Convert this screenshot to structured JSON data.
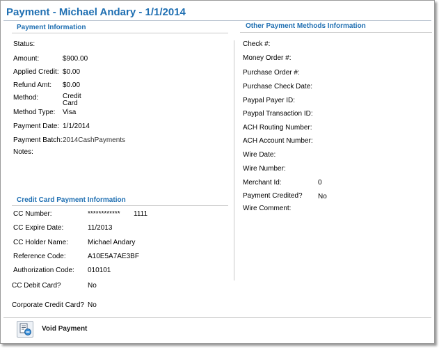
{
  "title": "Payment - Michael Andary - 1/1/2014",
  "payment_info": {
    "heading": "Payment Information",
    "fields": [
      {
        "label": "Status:",
        "value": ""
      },
      {
        "label": "Amount:",
        "value": "$900.00"
      },
      {
        "label": "Applied Credit:",
        "value": "$0.00"
      },
      {
        "label": "Refund Amt:",
        "value": "$0.00"
      },
      {
        "label": "Method:",
        "value": "Credit Card"
      },
      {
        "label": "Method Type:",
        "value": "Visa"
      },
      {
        "label": "Payment Date:",
        "value": "1/1/2014"
      },
      {
        "label": "Payment Batch:",
        "value": "2014CashPayments"
      },
      {
        "label": "Notes:",
        "value": ""
      }
    ]
  },
  "cc_info": {
    "heading": "Credit Card Payment Information",
    "fields": [
      {
        "label": "CC Number:",
        "value": "************",
        "value2": "1111"
      },
      {
        "label": "CC Expire Date:",
        "value": "11/2013"
      },
      {
        "label": "CC Holder Name:",
        "value": "Michael Andary"
      },
      {
        "label": "Reference Code:",
        "value": "A10E5A7AE3BF"
      },
      {
        "label": "Authorization Code:",
        "value": "010101"
      },
      {
        "label": "CC Debit Card?",
        "value": "No"
      },
      {
        "label": "Corporate Credit Card?",
        "value": "No"
      }
    ]
  },
  "other_info": {
    "heading": "Other Payment Methods Information",
    "fields": [
      {
        "label": "Check #:",
        "value": ""
      },
      {
        "label": "Money Order #:",
        "value": ""
      },
      {
        "label": "Purchase Order #:",
        "value": ""
      },
      {
        "label": "Purchase Check Date:",
        "value": ""
      },
      {
        "label": "Paypal Payer ID:",
        "value": ""
      },
      {
        "label": "Paypal Transaction ID:",
        "value": ""
      },
      {
        "label": "ACH Routing Number:",
        "value": ""
      },
      {
        "label": "ACH Account Number:",
        "value": ""
      },
      {
        "label": "Wire Date:",
        "value": ""
      },
      {
        "label": "Wire Number:",
        "value": ""
      },
      {
        "label": "Merchant Id:",
        "value": "0"
      },
      {
        "label": "Payment Credited?",
        "value": "No"
      },
      {
        "label": "Wire Comment:",
        "value": ""
      }
    ]
  },
  "footer": {
    "void_label": "Void Payment",
    "void_icon": "void-payment-icon"
  },
  "colors": {
    "heading": "#1f6fb2"
  }
}
